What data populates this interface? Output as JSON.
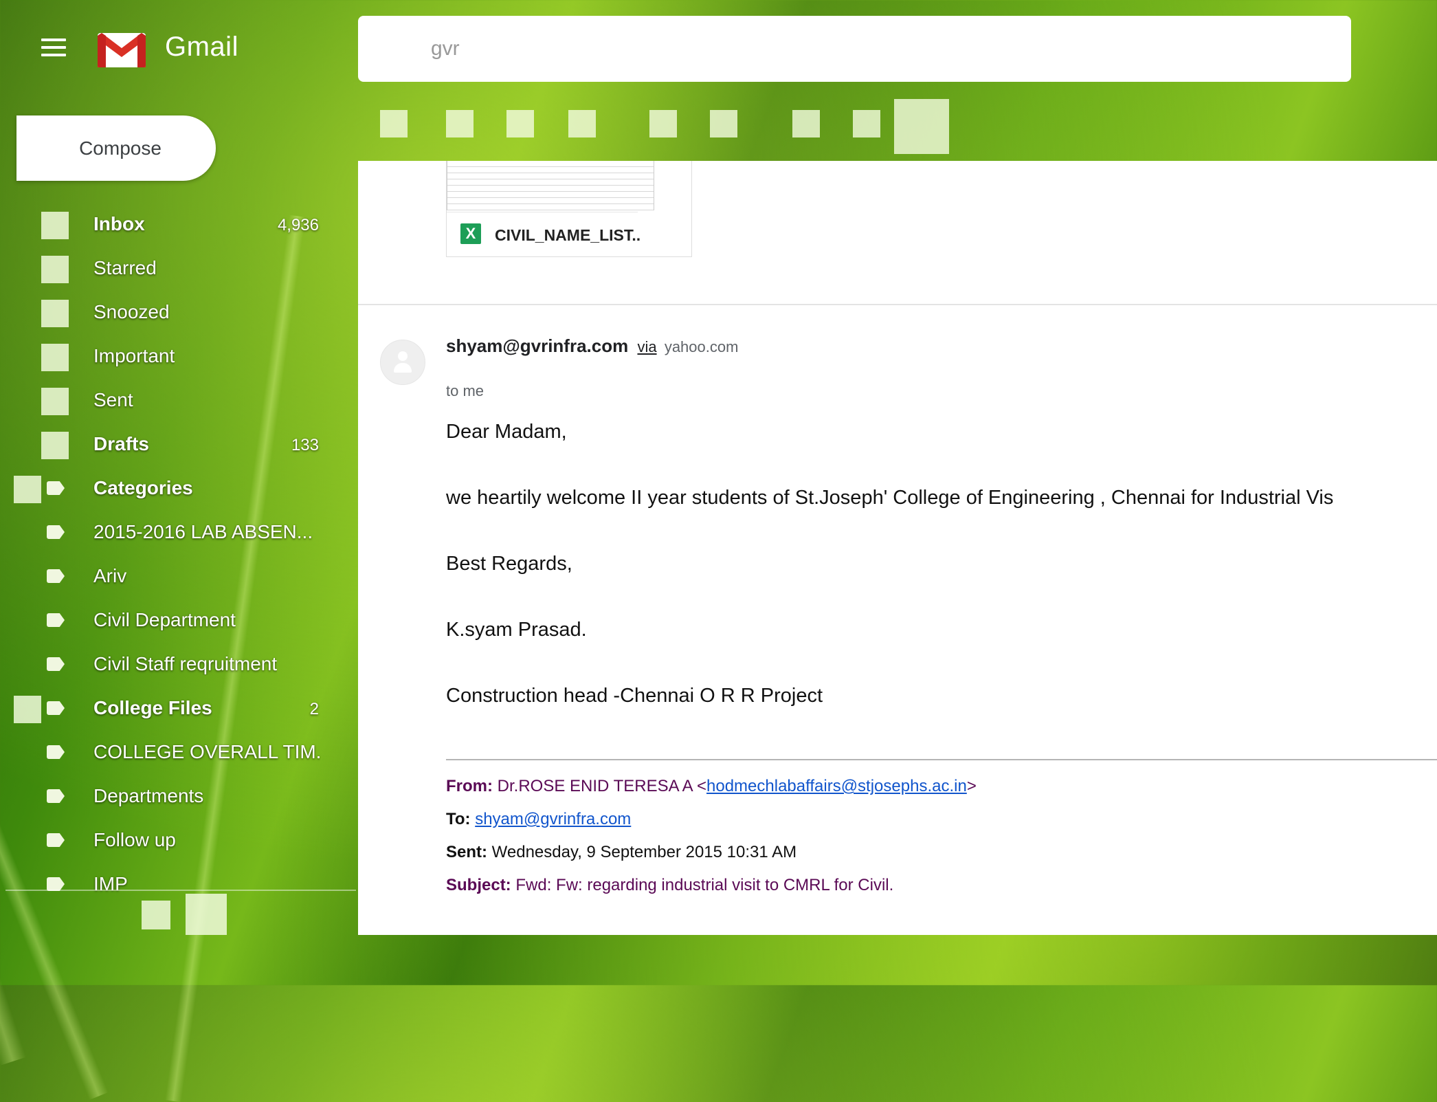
{
  "app": {
    "brand": "Gmail",
    "search_value": "gvr"
  },
  "sidebar": {
    "compose_label": "Compose",
    "items": [
      {
        "label": "Inbox",
        "count": "4,936"
      },
      {
        "label": "Starred",
        "count": ""
      },
      {
        "label": "Snoozed",
        "count": ""
      },
      {
        "label": "Important",
        "count": ""
      },
      {
        "label": "Sent",
        "count": ""
      },
      {
        "label": "Drafts",
        "count": "133"
      },
      {
        "label": "Categories",
        "count": ""
      },
      {
        "label": "2015-2016 LAB ABSEN...",
        "count": ""
      },
      {
        "label": "Ariv",
        "count": ""
      },
      {
        "label": "Civil Department",
        "count": ""
      },
      {
        "label": "Civil Staff reqruitment",
        "count": ""
      },
      {
        "label": "College Files",
        "count": "2"
      },
      {
        "label": "COLLEGE OVERALL TIM...",
        "count": ""
      },
      {
        "label": "Departments",
        "count": ""
      },
      {
        "label": "Follow up",
        "count": ""
      },
      {
        "label": "IMP",
        "count": ""
      }
    ]
  },
  "attachment": {
    "name": "CIVIL_NAME_LIST..",
    "icon": "X"
  },
  "message": {
    "sender_email": "shyam@gvrinfra.com",
    "via_label": "via",
    "via_domain": "yahoo.com",
    "recipient_line": "to me",
    "body": [
      "Dear Madam,",
      "we heartily welcome  II year students of St.Joseph'  College of Engineering , Chennai  for Industrial Vis",
      "Best Regards,",
      "K.syam Prasad.",
      "Construction head -Chennai O R R Project"
    ],
    "quoted": {
      "from_label": "From:",
      "from_name": "Dr.ROSE ENID TERESA A <",
      "from_email": "hodmechlabaffairs@stjosephs.ac.in",
      "from_close": ">",
      "to_label": "To:",
      "to_email": "shyam@gvrinfra.com",
      "sent_label": "Sent:",
      "sent_value": "Wednesday, 9 September 2015 10:31 AM",
      "subject_label": "Subject:",
      "subject_value": "Fwd: Fw: regarding industrial visit to CMRL for Civil."
    }
  },
  "colors": {
    "gmail_red": "#d93025",
    "quote_purple": "#5a0a55",
    "link_blue": "#1155cc",
    "excel_green": "#1d9e57"
  }
}
